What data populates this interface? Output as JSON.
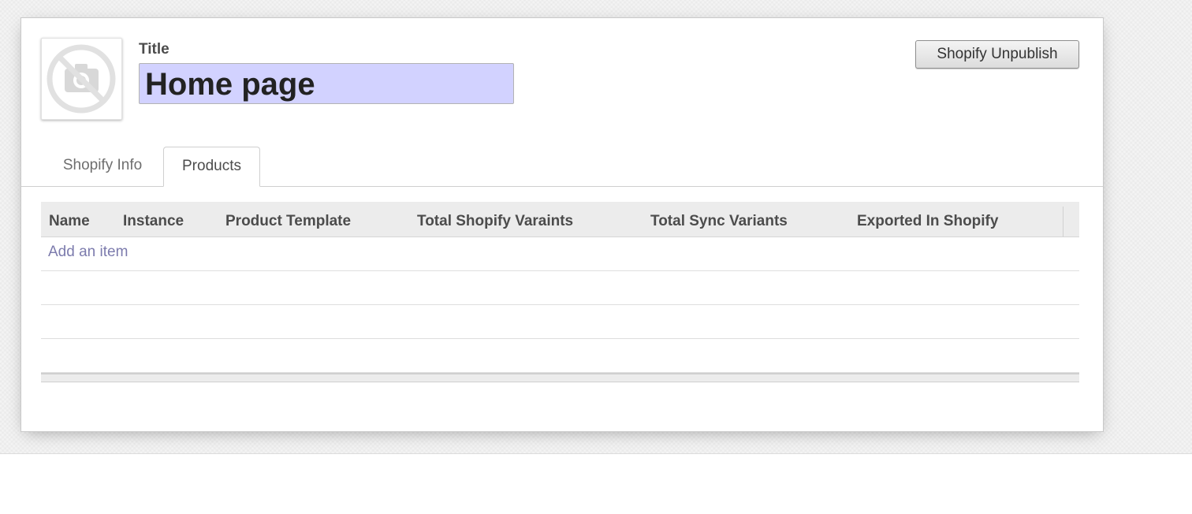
{
  "form": {
    "title_label": "Title",
    "title_value": "Home page",
    "unpublish_label": "Shopify Unpublish",
    "image_icon": "camera-off-icon"
  },
  "tabs": [
    {
      "label": "Shopify Info",
      "active": false
    },
    {
      "label": "Products",
      "active": true
    }
  ],
  "table": {
    "columns": [
      "Name",
      "Instance",
      "Product Template",
      "Total Shopify Varaints",
      "Total Sync Variants",
      "Exported In Shopify"
    ],
    "add_item_label": "Add an item",
    "rows": []
  },
  "colors": {
    "title_field_bg": "#d2d2ff",
    "link": "#7c7bad"
  }
}
